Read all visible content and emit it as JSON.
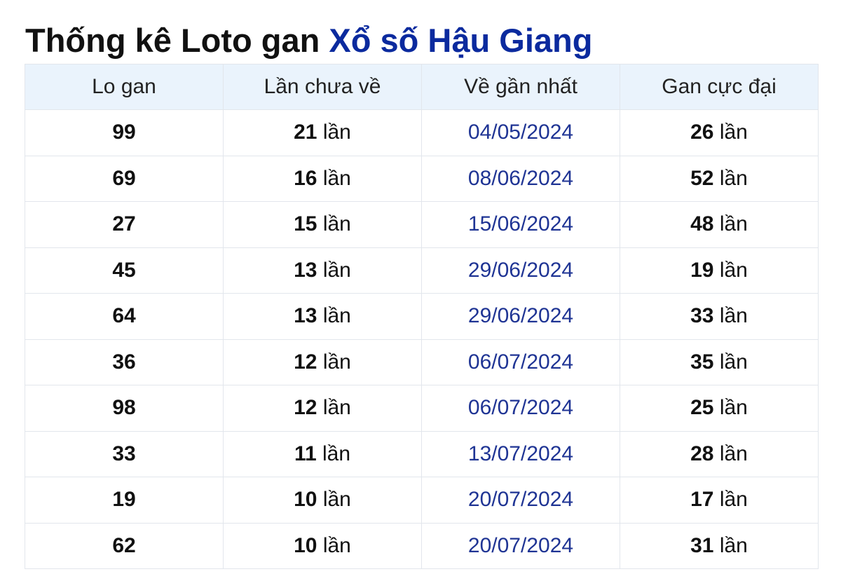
{
  "title": {
    "prefix": "Thống kê Loto gan",
    "highlight": "Xổ số Hậu Giang"
  },
  "colors": {
    "title_accent": "#0b2a9e",
    "date_text": "#1f3494",
    "header_bg": "#eaf3fc"
  },
  "table": {
    "headers": [
      "Lo gan",
      "Lần chưa về",
      "Về gần nhất",
      "Gan cực đại"
    ],
    "unit": "lần",
    "rows": [
      {
        "lo": "99",
        "missed": "21",
        "last": "04/05/2024",
        "max": "26"
      },
      {
        "lo": "69",
        "missed": "16",
        "last": "08/06/2024",
        "max": "52"
      },
      {
        "lo": "27",
        "missed": "15",
        "last": "15/06/2024",
        "max": "48"
      },
      {
        "lo": "45",
        "missed": "13",
        "last": "29/06/2024",
        "max": "19"
      },
      {
        "lo": "64",
        "missed": "13",
        "last": "29/06/2024",
        "max": "33"
      },
      {
        "lo": "36",
        "missed": "12",
        "last": "06/07/2024",
        "max": "35"
      },
      {
        "lo": "98",
        "missed": "12",
        "last": "06/07/2024",
        "max": "25"
      },
      {
        "lo": "33",
        "missed": "11",
        "last": "13/07/2024",
        "max": "28"
      },
      {
        "lo": "19",
        "missed": "10",
        "last": "20/07/2024",
        "max": "17"
      },
      {
        "lo": "62",
        "missed": "10",
        "last": "20/07/2024",
        "max": "31"
      }
    ]
  }
}
